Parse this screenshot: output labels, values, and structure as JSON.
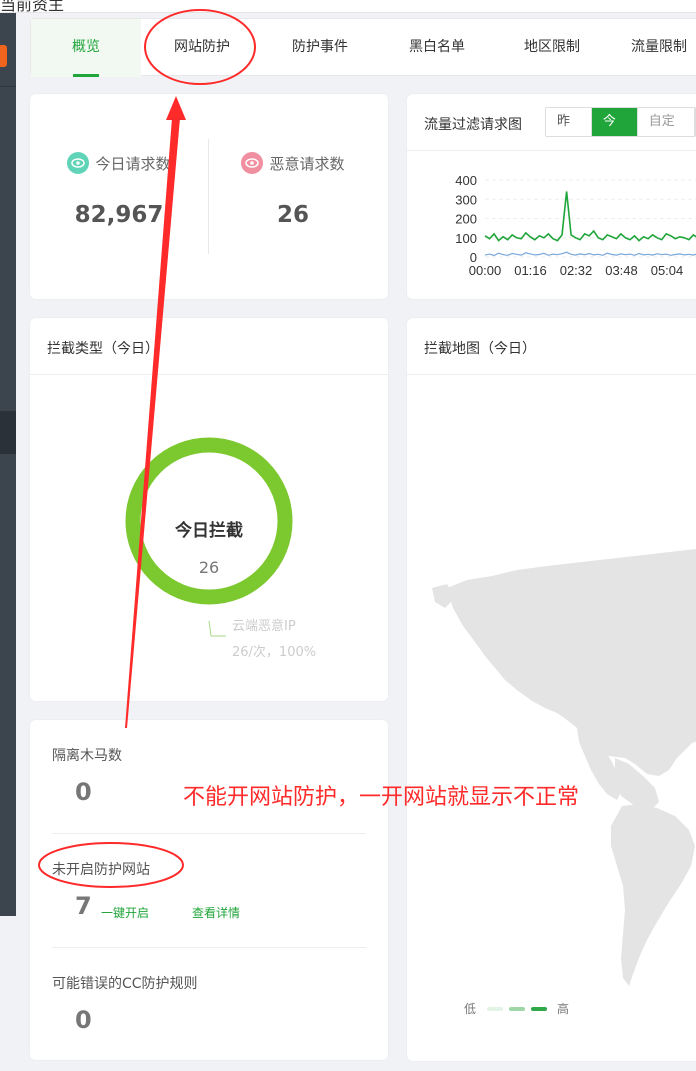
{
  "top_strip_text": "当前资主",
  "tabs": [
    {
      "label": "概览",
      "active": true
    },
    {
      "label": "网站防护"
    },
    {
      "label": "防护事件"
    },
    {
      "label": "黑白名单"
    },
    {
      "label": "地区限制"
    },
    {
      "label": "流量限制"
    }
  ],
  "stats": {
    "requests": {
      "label": "今日请求数",
      "value": "82,967",
      "color": "#5fd4b6"
    },
    "malicious": {
      "label": "恶意请求数",
      "value": "26",
      "color": "#ef8f9f"
    }
  },
  "traffic_chart": {
    "title": "流量过滤请求图",
    "buttons": [
      "昨天",
      "今天",
      "自定义"
    ],
    "active_button": 1
  },
  "chart_data": {
    "type": "line",
    "title": "",
    "xlabel": "",
    "ylabel": "",
    "ylim": [
      0,
      400
    ],
    "y_ticks": [
      "400",
      "300",
      "200",
      "100",
      "0"
    ],
    "x_ticks": [
      "00:00",
      "01:16",
      "02:32",
      "03:48",
      "05:04"
    ],
    "grid": true,
    "series": [
      {
        "color": "#20a53a",
        "values": [
          110,
          95,
          120,
          85,
          105,
          90,
          115,
          100,
          95,
          125,
          105,
          90,
          110,
          100,
          120,
          95,
          85,
          115,
          340,
          115,
          100,
          90,
          120,
          110,
          135,
          100,
          90,
          115,
          105,
          95,
          120,
          100,
          90,
          110,
          85,
          105,
          95,
          115,
          100,
          90,
          120,
          110,
          95,
          105,
          100,
          90,
          115,
          100,
          120,
          95
        ]
      },
      {
        "color": "#7ba7d9",
        "values": [
          10,
          15,
          8,
          20,
          12,
          9,
          18,
          14,
          10,
          22,
          16,
          11,
          13,
          19,
          9,
          15,
          12,
          17,
          25,
          14,
          10,
          16,
          12,
          18,
          11,
          14,
          9,
          20,
          13,
          10,
          16,
          12,
          15,
          9,
          18,
          11,
          14,
          10,
          17,
          12,
          15,
          9,
          13,
          16,
          11,
          14,
          10,
          18,
          12,
          15
        ]
      }
    ]
  },
  "intercept_type": {
    "title": "拦截类型（今日）",
    "center_label": "今日拦截",
    "center_value": "26",
    "ring_color": "#7cc82f",
    "legend_name": "云端恶意IP",
    "legend_value": "26/次，100%"
  },
  "intercept_map": {
    "title": "拦截地图（今日）",
    "legend_low": "低",
    "legend_high": "高"
  },
  "side_stats": {
    "trojan_label": "隔离木马数",
    "trojan_value": "0",
    "unprotected_label": "未开启防护网站",
    "unprotected_value": "7",
    "enable_link": "一键开启",
    "detail_link": "查看详情",
    "cc_label": "可能错误的CC防护规则",
    "cc_value": "0"
  },
  "annotation_text": "不能开网站防护，一开网站就显示不正常",
  "annotation_color": "#ff2a2a"
}
